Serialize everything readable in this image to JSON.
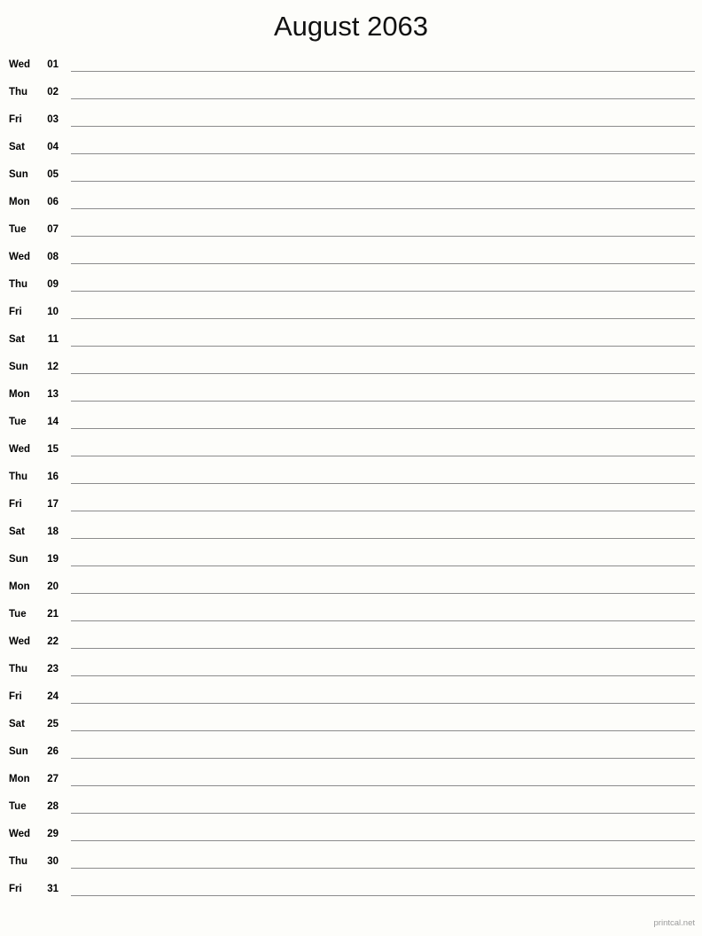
{
  "page": {
    "title": "August 2063",
    "month_name": "August",
    "year": "2063",
    "background_color": "#fdfdfa",
    "line_color": "#8c8c8c",
    "text_color": "#000000"
  },
  "footer": {
    "credit": "printcal.net",
    "color": "#9a9a9a"
  },
  "calendar": {
    "days": [
      {
        "weekday": "Wed",
        "date": "01"
      },
      {
        "weekday": "Thu",
        "date": "02"
      },
      {
        "weekday": "Fri",
        "date": "03"
      },
      {
        "weekday": "Sat",
        "date": "04"
      },
      {
        "weekday": "Sun",
        "date": "05"
      },
      {
        "weekday": "Mon",
        "date": "06"
      },
      {
        "weekday": "Tue",
        "date": "07"
      },
      {
        "weekday": "Wed",
        "date": "08"
      },
      {
        "weekday": "Thu",
        "date": "09"
      },
      {
        "weekday": "Fri",
        "date": "10"
      },
      {
        "weekday": "Sat",
        "date": "11"
      },
      {
        "weekday": "Sun",
        "date": "12"
      },
      {
        "weekday": "Mon",
        "date": "13"
      },
      {
        "weekday": "Tue",
        "date": "14"
      },
      {
        "weekday": "Wed",
        "date": "15"
      },
      {
        "weekday": "Thu",
        "date": "16"
      },
      {
        "weekday": "Fri",
        "date": "17"
      },
      {
        "weekday": "Sat",
        "date": "18"
      },
      {
        "weekday": "Sun",
        "date": "19"
      },
      {
        "weekday": "Mon",
        "date": "20"
      },
      {
        "weekday": "Tue",
        "date": "21"
      },
      {
        "weekday": "Wed",
        "date": "22"
      },
      {
        "weekday": "Thu",
        "date": "23"
      },
      {
        "weekday": "Fri",
        "date": "24"
      },
      {
        "weekday": "Sat",
        "date": "25"
      },
      {
        "weekday": "Sun",
        "date": "26"
      },
      {
        "weekday": "Mon",
        "date": "27"
      },
      {
        "weekday": "Tue",
        "date": "28"
      },
      {
        "weekday": "Wed",
        "date": "29"
      },
      {
        "weekday": "Thu",
        "date": "30"
      },
      {
        "weekday": "Fri",
        "date": "31"
      }
    ]
  }
}
